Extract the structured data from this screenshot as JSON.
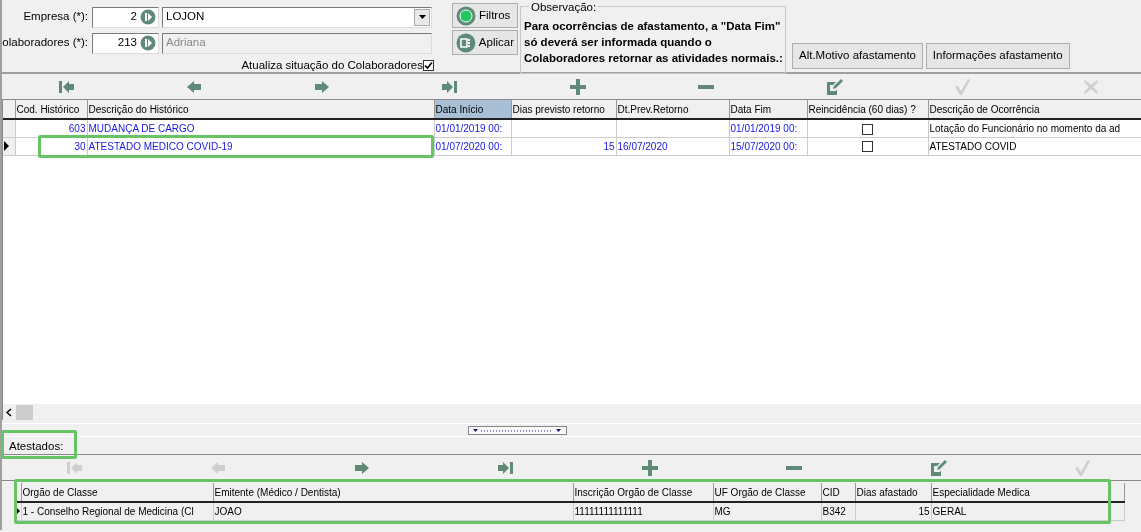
{
  "form": {
    "fields": [
      {
        "label": "Empresa (*):",
        "code": "2",
        "value": "LOJON",
        "kind": "dropdown",
        "disabled": false
      },
      {
        "label": "olaboradores (*):",
        "code": "213",
        "value": "Adriana",
        "kind": "text",
        "disabled": true
      }
    ],
    "update_checkbox": {
      "label": "Atualiza situação do Colaboradores",
      "checked": true
    }
  },
  "action_buttons": [
    {
      "label": "Filtros",
      "kind": "filter"
    },
    {
      "label": "Aplicar",
      "kind": "apply"
    }
  ],
  "observation": {
    "title": "Observação:",
    "lines": [
      "Para ocorrências de afastamento, a \"Data Fim\"",
      "só deverá ser informada quando o",
      "Colaboradores retornar as atividades normais.:"
    ]
  },
  "buttons": [
    "Alt.Motivo afastamento",
    "Informações afastamento"
  ],
  "toolbar": [
    {
      "kind": "first",
      "disabled": false
    },
    {
      "kind": "prev",
      "disabled": false
    },
    {
      "kind": "next",
      "disabled": false
    },
    {
      "kind": "last",
      "disabled": false
    },
    {
      "kind": "add",
      "disabled": false
    },
    {
      "kind": "remove",
      "disabled": false
    },
    {
      "kind": "edit",
      "disabled": false
    },
    {
      "kind": "confirm",
      "disabled": true
    },
    {
      "kind": "cancel",
      "disabled": true
    }
  ],
  "history_grid": {
    "columns": [
      {
        "label": "Cod. Histórico",
        "kind": "number",
        "selected": false
      },
      {
        "label": "Descrição do Histórico",
        "kind": "text",
        "selected": false
      },
      {
        "label": "Data Início",
        "kind": "text",
        "selected": true
      },
      {
        "label": "Dias previsto retorno",
        "kind": "number",
        "selected": false
      },
      {
        "label": "Dt.Prev.Retorno",
        "kind": "text",
        "selected": false
      },
      {
        "label": "Data Fim",
        "kind": "text",
        "selected": false
      },
      {
        "label": "Reincidência (60 dias) ?",
        "kind": "check",
        "selected": false
      },
      {
        "label": "Descrição de Ocorrência",
        "kind": "note",
        "selected": false
      }
    ],
    "rows": [
      {
        "current": false,
        "cells": [
          "603",
          "MUDANÇA DE CARGO",
          "01/01/2019 00:",
          null,
          null,
          "01/01/2019 00:",
          false,
          "Lotação do Funcionário no momento da ad"
        ]
      },
      {
        "current": true,
        "cells": [
          "30",
          "ATESTADO MEDICO COVID-19",
          "01/07/2020 00:",
          "15",
          "16/07/2020",
          "15/07/2020 00:",
          false,
          "ATESTADO COVID"
        ]
      }
    ]
  },
  "certificates": {
    "title": "Atestados:",
    "toolbar": [
      {
        "kind": "first",
        "disabled": true
      },
      {
        "kind": "prev",
        "disabled": true
      },
      {
        "kind": "next",
        "disabled": false
      },
      {
        "kind": "last",
        "disabled": false
      },
      {
        "kind": "add",
        "disabled": false
      },
      {
        "kind": "remove",
        "disabled": false
      },
      {
        "kind": "edit",
        "disabled": false
      },
      {
        "kind": "confirm",
        "disabled": true
      }
    ],
    "columns": [
      {
        "label": "Orgão de Classe",
        "kind": "text"
      },
      {
        "label": "Emitente (Médico / Dentista)",
        "kind": "text"
      },
      {
        "label": "Inscrição Orgão de Classe",
        "kind": "text"
      },
      {
        "label": "UF Orgão de Classe",
        "kind": "text"
      },
      {
        "label": "CID",
        "kind": "text"
      },
      {
        "label": "Dias afastado",
        "kind": "number"
      },
      {
        "label": "Especialidade Medica",
        "kind": "text"
      }
    ],
    "rows": [
      {
        "current": true,
        "cells": [
          "1 - Conselho Regional de Medicina (Cl",
          "JOAO",
          "11111111111111",
          "MG",
          "B342",
          "15",
          "GERAL"
        ]
      }
    ]
  }
}
